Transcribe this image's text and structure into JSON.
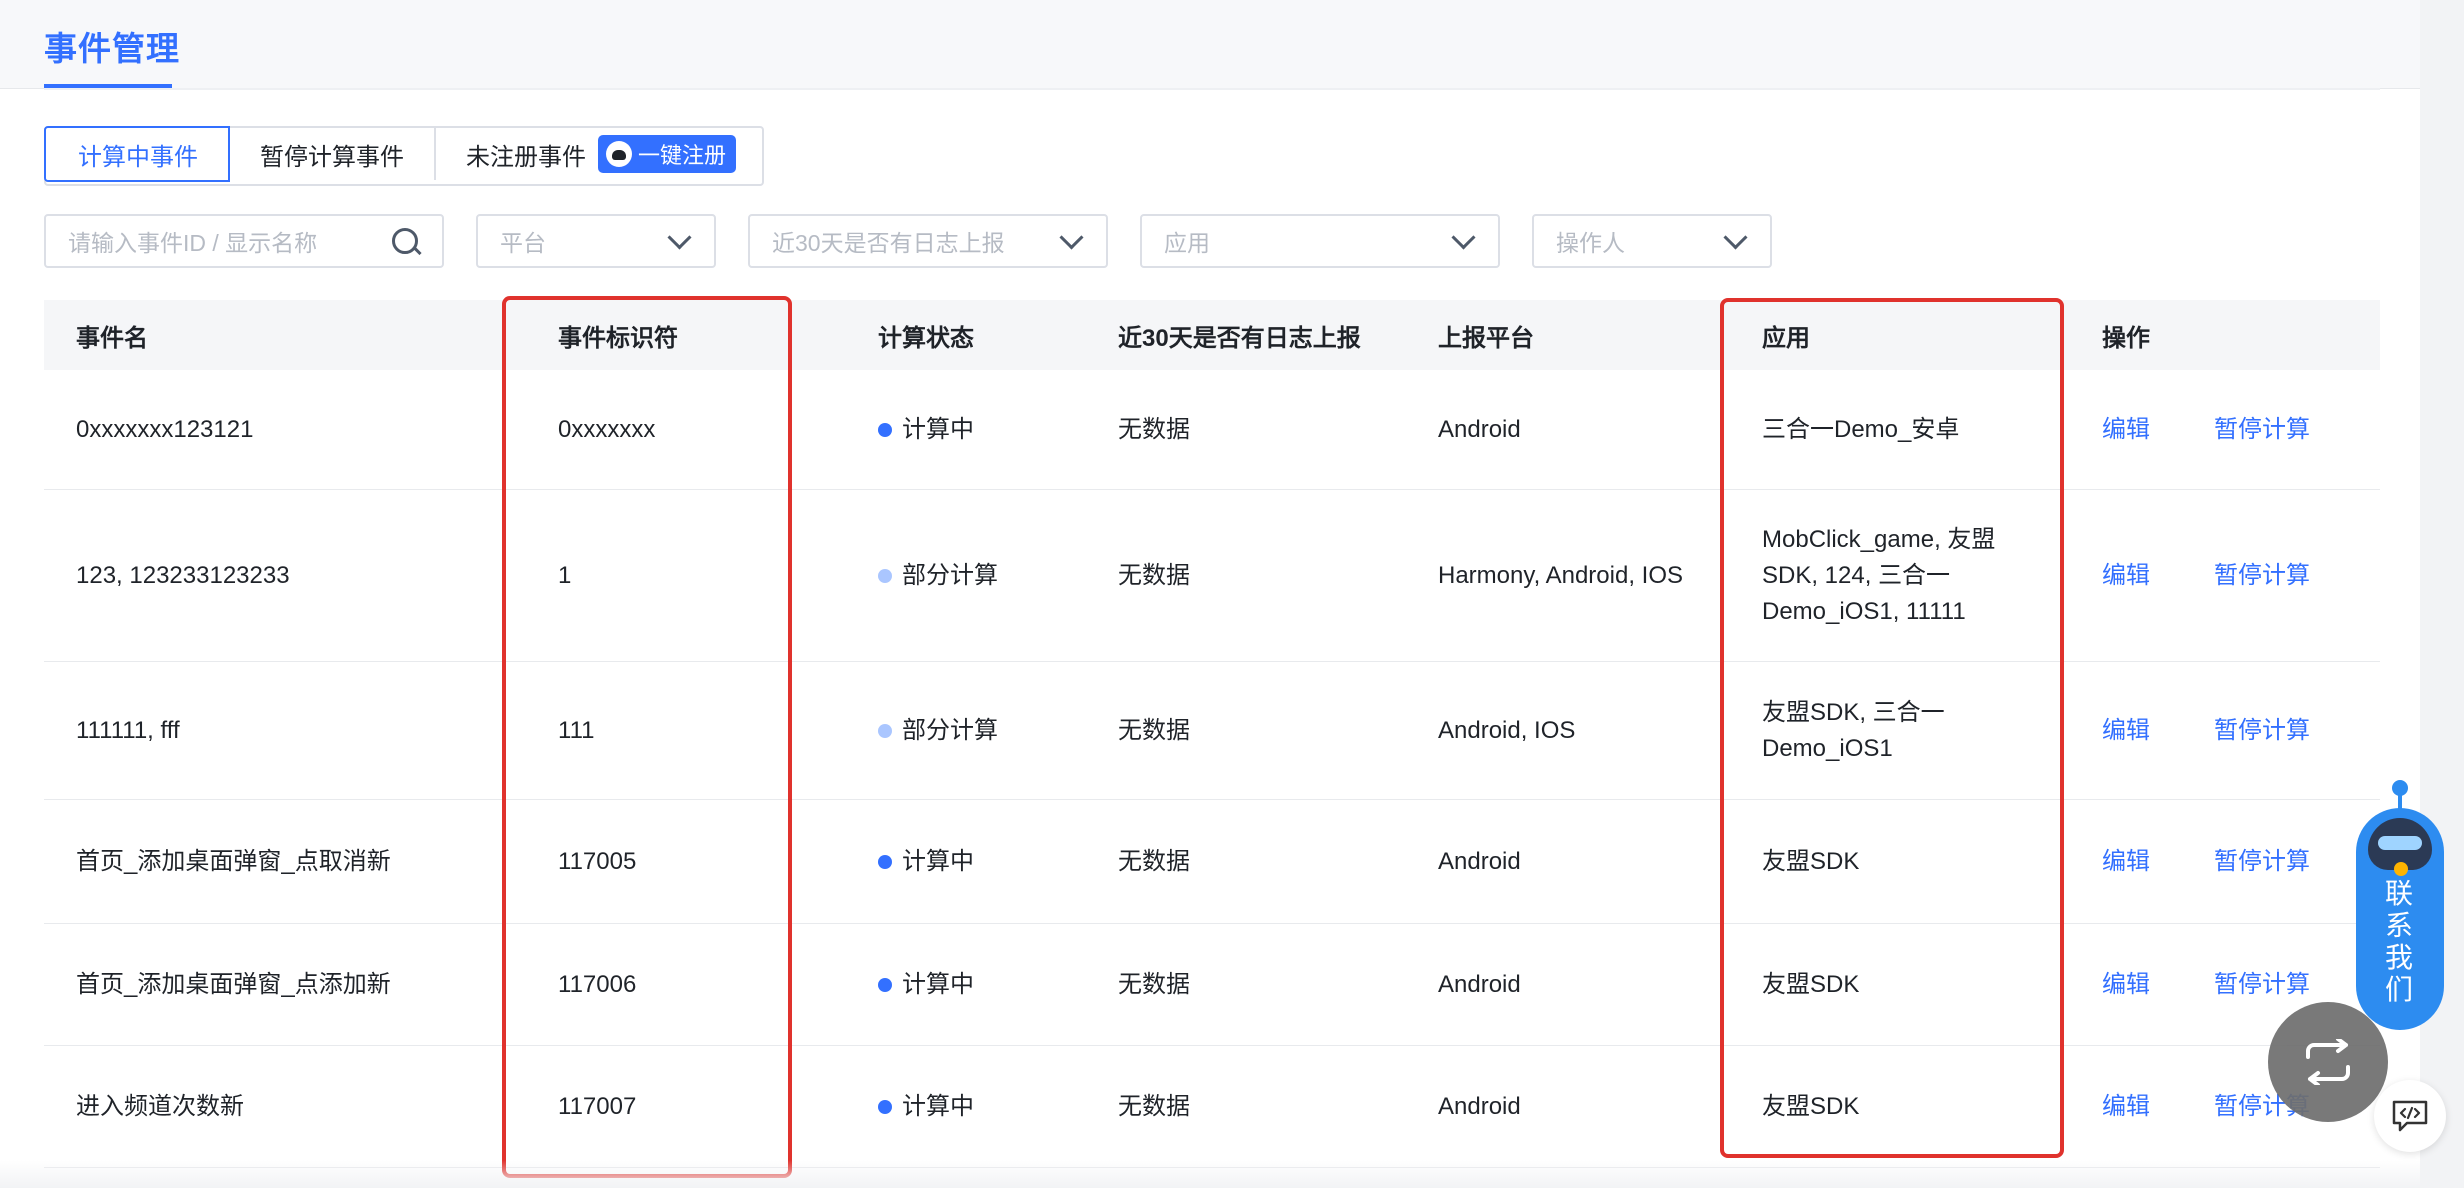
{
  "page": {
    "title": "事件管理"
  },
  "tabs": [
    {
      "label": "计算中事件",
      "active": true
    },
    {
      "label": "暂停计算事件",
      "active": false
    },
    {
      "label": "未注册事件",
      "active": false
    }
  ],
  "register_button": {
    "label": "一键注册",
    "icon": "robot-icon"
  },
  "filters": {
    "search_placeholder": "请输入事件ID / 显示名称",
    "platform_placeholder": "平台",
    "log_placeholder": "近30天是否有日志上报",
    "app_placeholder": "应用",
    "operator_placeholder": "操作人"
  },
  "table": {
    "headers": [
      "事件名",
      "事件标识符",
      "计算状态",
      "近30天是否有日志上报",
      "上报平台",
      "应用",
      "操作"
    ],
    "rows": [
      {
        "name": "0xxxxxxx123121",
        "id": "0xxxxxxx",
        "status": "计算中",
        "status_color": "#3370ff",
        "log": "无数据",
        "platform": "Android",
        "app": "三合一Demo_安卓",
        "edit": "编辑",
        "pause": "暂停计算"
      },
      {
        "name": "123, 123233123233",
        "id": "1",
        "status": "部分计算",
        "status_color": "#aac6ff",
        "log": "无数据",
        "platform": "Harmony, Android, IOS",
        "app": "MobClick_game, 友盟SDK, 124, 三合一Demo_iOS1, 11111",
        "edit": "编辑",
        "pause": "暂停计算"
      },
      {
        "name": "111111, fff",
        "id": "111",
        "status": "部分计算",
        "status_color": "#aac6ff",
        "log": "无数据",
        "platform": "Android, IOS",
        "app": "友盟SDK, 三合一Demo_iOS1",
        "edit": "编辑",
        "pause": "暂停计算"
      },
      {
        "name": "首页_添加桌面弹窗_点取消新",
        "id": "117005",
        "status": "计算中",
        "status_color": "#3370ff",
        "log": "无数据",
        "platform": "Android",
        "app": "友盟SDK",
        "edit": "编辑",
        "pause": "暂停计算"
      },
      {
        "name": "首页_添加桌面弹窗_点添加新",
        "id": "117006",
        "status": "计算中",
        "status_color": "#3370ff",
        "log": "无数据",
        "platform": "Android",
        "app": "友盟SDK",
        "edit": "编辑",
        "pause": "暂停计算"
      },
      {
        "name": "进入频道次数新",
        "id": "117007",
        "status": "计算中",
        "status_color": "#3370ff",
        "log": "无数据",
        "platform": "Android",
        "app": "友盟SDK",
        "edit": "编辑",
        "pause": "暂停计算"
      }
    ]
  },
  "contact_widget": {
    "label": "联系我们",
    "icon": "robot-assistant-icon"
  },
  "floating": {
    "swap_icon": "swap-arrows-icon",
    "code_icon": "code-chat-icon"
  },
  "colors": {
    "accent": "#3370ff",
    "highlight": "#e0322d"
  }
}
